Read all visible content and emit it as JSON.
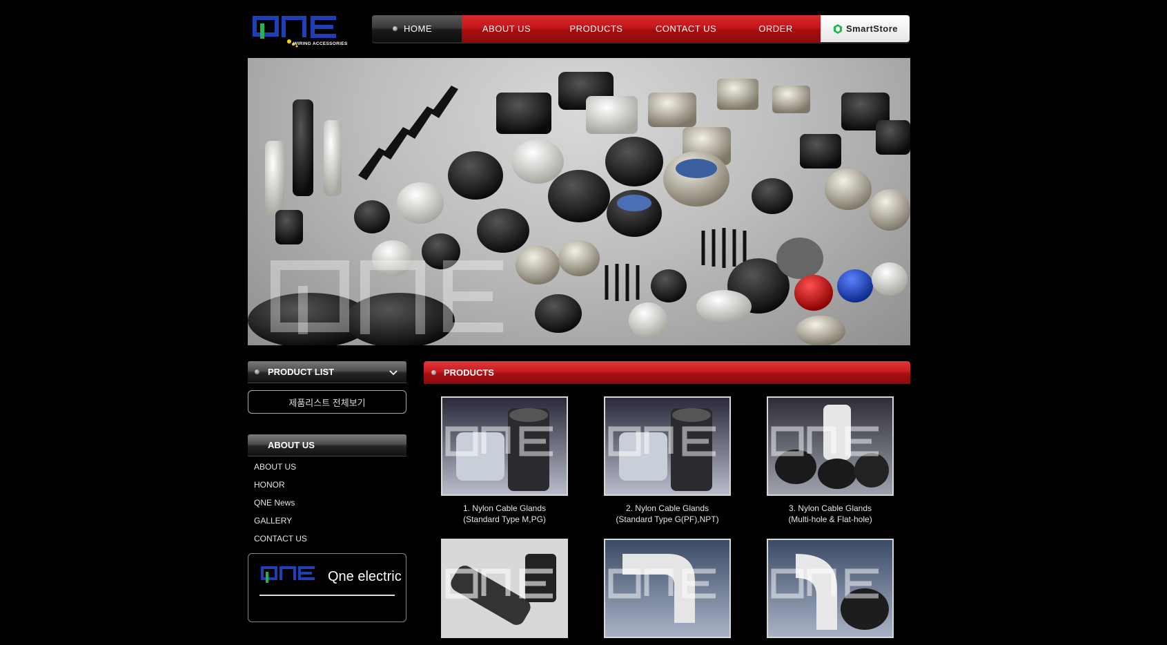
{
  "logo": {
    "main": "QNE",
    "tagline": "WIRING ACCESSORIES"
  },
  "nav": {
    "items": [
      "HOME",
      "ABOUT US",
      "PRODUCTS",
      "CONTACT US",
      "ORDER"
    ],
    "smartstore": "SmartStore"
  },
  "banner": {
    "watermark": "QNE"
  },
  "sidebar": {
    "product_list": {
      "title": "PRODUCT LIST",
      "view_all": "제품리스트 전체보기"
    },
    "about": {
      "title": "ABOUT US",
      "links": [
        "ABOUT US",
        "HONOR",
        "QNE News",
        "GALLERY",
        "CONTACT US"
      ]
    },
    "company": {
      "logo": "QNE",
      "name": "Qne electric"
    }
  },
  "products": {
    "title": "PRODUCTS",
    "items": [
      {
        "line1": "1. Nylon Cable Glands",
        "line2": "(Standard Type M,PG)"
      },
      {
        "line1": "2. Nylon Cable Glands",
        "line2": "(Standard Type G(PF),NPT)"
      },
      {
        "line1": "3. Nylon Cable Glands",
        "line2": "(Multi-hole & Flat-hole)"
      },
      {
        "line1": "",
        "line2": ""
      },
      {
        "line1": "",
        "line2": ""
      },
      {
        "line1": "",
        "line2": ""
      }
    ]
  },
  "colors": {
    "accent_red": "#c3171b",
    "logo_blue": "#1f3fb5",
    "logo_green": "#27b24a",
    "logo_yellow": "#ffd000"
  }
}
